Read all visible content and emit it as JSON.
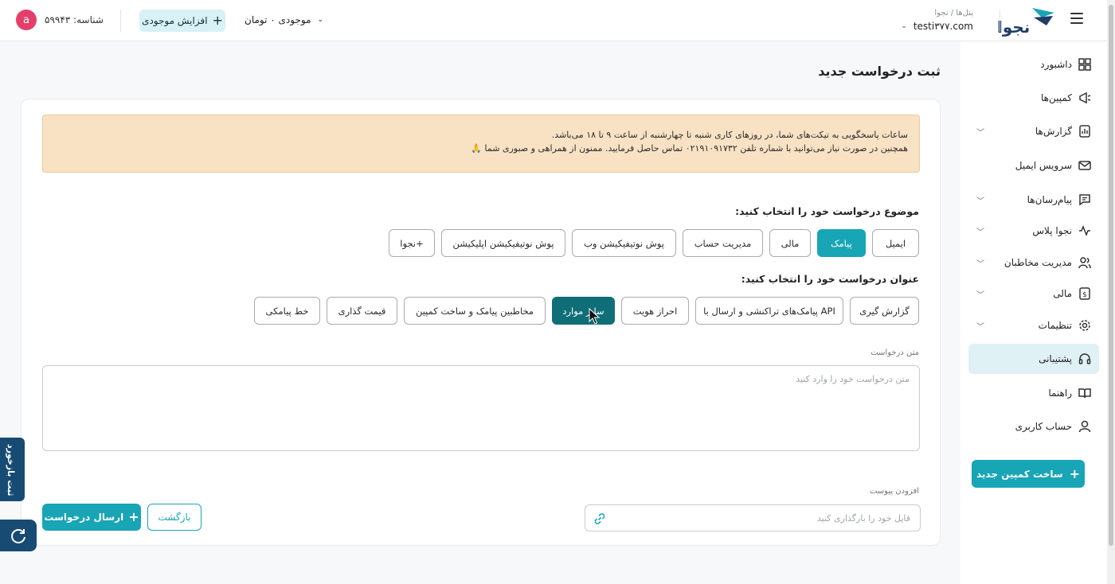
{
  "header": {
    "breadcrumb": "پنل‌ها / نجوا",
    "account": "testi۳۷۷.com",
    "balance_label": "موجودی ۰ تومان",
    "topup_label": "افزایش موجودی",
    "id_label": "شناسه: ۵۹۹۴۳",
    "avatar_letter": "a",
    "logo_text": "نجوا"
  },
  "sidebar": {
    "items": [
      {
        "label": "داشبورد",
        "icon": "dashboard-icon"
      },
      {
        "label": "کمپین‌ها",
        "icon": "megaphone-icon"
      },
      {
        "label": "گزارش‌ها",
        "icon": "report-icon"
      },
      {
        "label": "سرویس ایمیل",
        "icon": "mail-icon"
      },
      {
        "label": "پیام‌رسان‌ها",
        "icon": "message-icon"
      },
      {
        "label": "نجوا پلاس",
        "icon": "plus-app-icon"
      },
      {
        "label": "مدیریت مخاطبان",
        "icon": "contacts-icon"
      },
      {
        "label": "مالی",
        "icon": "finance-icon"
      },
      {
        "label": "تنظیمات",
        "icon": "settings-icon"
      },
      {
        "label": "پشتیبانی",
        "icon": "headset-icon"
      },
      {
        "label": "راهنما",
        "icon": "book-icon"
      },
      {
        "label": "حساب کاربری",
        "icon": "user-icon"
      }
    ],
    "new_campaign_label": "ساخت کمپین جدید"
  },
  "main": {
    "title": "ثبت درخواست جدید",
    "notice_line1": "ساعات پاسخگویی به تیکت‌های شما، در روزهای کاری شنبه تا چهارشنبه از ساعت ۹ تا ۱۸ می‌باشد.",
    "notice_line2": "همچنین در صورت نیاز می‌توانید با شماره تلفن ۰۲۱۹۱۰۹۱۷۳۲ تماس حاصل فرمایید. ممنون از همراهی و صبوری شما 🙏",
    "subject_label": "موضوع درخواست خود را انتخاب کنید:",
    "subjects": [
      "ایمیل",
      "پیامک",
      "مالی",
      "مدیریت حساب",
      "پوش نوتیفیکیشن وب",
      "پوش نوتیفیکیشن اپلیکیشن",
      "نجوا+"
    ],
    "selected_subject": "پیامک",
    "title_label": "عنوان درخواست خود را انتخاب کنید:",
    "titles": [
      "گزارش گیری",
      "پیامک‌های تراکنشی و ارسال با API",
      "احراز هویت",
      "سایر موارد",
      "مخاطبین پیامک و ساخت کمپین",
      "قیمت گذاری",
      "خط پیامکی"
    ],
    "selected_title": "سایر موارد",
    "text_label": "متن درخواست",
    "text_placeholder": "متن درخواست خود را وارد کنید",
    "attach_label": "افزودن پیوست",
    "attach_placeholder": "فایل خود را بارگذاری کنید",
    "send_label": "ارسال درخواست",
    "back_label": "بازگشت"
  },
  "floating": {
    "feedback_label": "ثبت بازخورد"
  },
  "colors": {
    "accent": "#18a5b5",
    "accent_dark": "#0f6e78",
    "notice_bg": "#f8e2c3",
    "float_bg": "#174b73",
    "avatar": "#e53e6a"
  }
}
